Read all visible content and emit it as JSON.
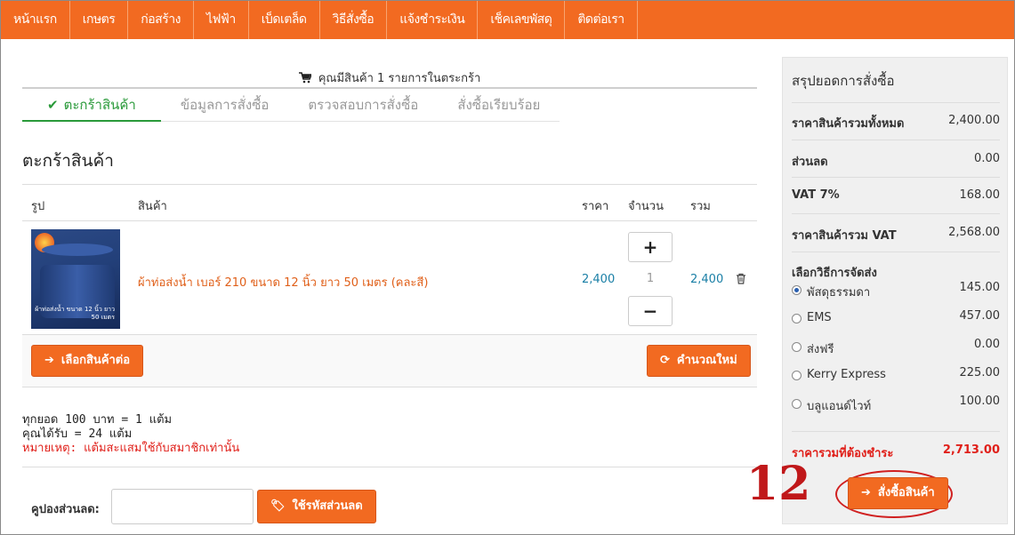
{
  "nav": {
    "items": [
      "หน้าแรก",
      "เกษตร",
      "ก่อสร้าง",
      "ไฟฟ้า",
      "เบ็ดเตล็ด",
      "วิธีสั่งซื้อ",
      "แจ้งชำระเงิน",
      "เช็คเลขพัสดุ",
      "ติดต่อเรา"
    ]
  },
  "cart_message": "คุณมีสินค้า 1 รายการในตระกร้า",
  "steps": [
    "ตะกร้าสินค้า",
    "ข้อมูลการสั่งซื้อ",
    "ตรวจสอบการสั่งซื้อ",
    "สั่งซื้อเรียบร้อย"
  ],
  "page_title": "ตะกร้าสินค้า",
  "table": {
    "headers": {
      "image": "รูป",
      "product": "สินค้า",
      "price": "ราคา",
      "qty": "จำนวน",
      "total": "รวม"
    },
    "rows": [
      {
        "name": "ผ้าท่อส่งน้ำ เบอร์ 210 ขนาด 12 นิ้ว ยาว 50 เมตร (คละสี)",
        "price": "2,400",
        "qty": "1",
        "total": "2,400",
        "image_label": "ผ้าท่อส่งน้ำ ขนาด 12 นิ้ว ยาว 50 เมตร"
      }
    ]
  },
  "buttons": {
    "continue_shopping": "เลือกสินค้าต่อ",
    "recalculate": "คำนวณใหม่",
    "apply_coupon": "ใช้รหัสส่วนลด",
    "checkout": "สั่งซื้อสินค้า",
    "plus": "+",
    "minus": "−"
  },
  "points": {
    "line1": "ทุกยอด 100 บาท = 1 แต้ม",
    "line2": "คุณได้รับ = 24 แต้ม",
    "note": "หมายเหตุ: แต้มสะแสมใช้กับสมาชิกเท่านั้น"
  },
  "coupon": {
    "label": "คูปองส่วนลด:",
    "value": ""
  },
  "summary": {
    "title": "สรุปยอดการสั่งซื้อ",
    "subtotal_label": "ราคาสินค้ารวมทั้งหมด",
    "subtotal": "2,400.00",
    "discount_label": "ส่วนลด",
    "discount": "0.00",
    "vat_label": "VAT 7%",
    "vat": "168.00",
    "with_vat_label": "ราคาสินค้ารวม VAT",
    "with_vat": "2,568.00",
    "shipping_label": "เลือกวิธีการจัดส่ง",
    "shipping": [
      {
        "name": "พัสดุธรรมดา",
        "price": "145.00",
        "selected": true
      },
      {
        "name": "EMS",
        "price": "457.00",
        "selected": false
      },
      {
        "name": "ส่งฟรี",
        "price": "0.00",
        "selected": false
      },
      {
        "name": "Kerry Express",
        "price": "225.00",
        "selected": false
      },
      {
        "name": "บลูแอนด์ไวท์",
        "price": "100.00",
        "selected": false
      }
    ],
    "grand_label": "ราคารวมที่ต้องชำระ",
    "grand": "2,713.00"
  },
  "annotation": "12",
  "colors": {
    "accent": "#f26a21",
    "link": "#1a7fa6",
    "success": "#2a9a3a",
    "alert": "#e0201a"
  },
  "icons": [
    "cart-icon",
    "check-icon",
    "trash-icon",
    "arrow-right-icon",
    "refresh-icon",
    "tag-icon"
  ]
}
